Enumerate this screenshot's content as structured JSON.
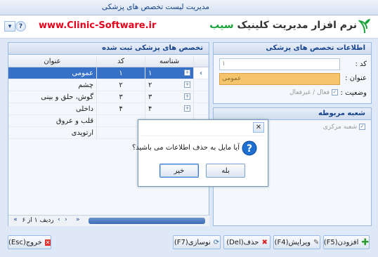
{
  "window": {
    "title": "مديريت ليست تخصص های پزشکی",
    "min_icon": "minimize-icon",
    "max_icon": "maximize-icon",
    "close_label": "✕"
  },
  "header": {
    "url": "www.Clinic-Software.ir",
    "logo_text_prefix": "نرم افزار مدیریت کلینیک ",
    "logo_text_brand": "سیب",
    "brand_color": "#18a33a",
    "url_color": "#e3001b"
  },
  "list_panel": {
    "title": "تخصص های پزشکی ثبت شده",
    "columns": [
      "شناسه",
      "کد",
      "عنوان"
    ],
    "rows": [
      {
        "id": "١",
        "code": "١",
        "title": "عمومی",
        "selected": true
      },
      {
        "id": "٢",
        "code": "٢",
        "title": "چشم",
        "selected": false
      },
      {
        "id": "٣",
        "code": "٣",
        "title": "گوش، حلق و بینی",
        "selected": false
      },
      {
        "id": "۴",
        "code": "۴",
        "title": "داخلی",
        "selected": false
      },
      {
        "id": "",
        "code": "",
        "title": "قلب و عروق",
        "selected": false
      },
      {
        "id": "",
        "code": "",
        "title": "ارتوپدی",
        "selected": false
      }
    ],
    "record_text": "ردیف ١ از ۶"
  },
  "info_panel": {
    "title": "اطلاعات تخصص های پزشکی",
    "code_label": "کد :",
    "code_value": "١",
    "title_label": "عنوان :",
    "title_value": "عمومی",
    "status_label": "وضعیت :",
    "status_text": "فعال / غیرفعال",
    "status_checked": true,
    "title_field_color": "#f6c46a"
  },
  "branch_panel": {
    "title": "شعبه مربوطه",
    "item": "شعبه مرکزی",
    "item_checked": true
  },
  "dialog": {
    "message": "آیا مایل به حذف اطلاعات می باشید؟",
    "yes_label": "بله",
    "no_label": "خیر",
    "close_label": "✕"
  },
  "toolbar": {
    "add_label": "افزودن(F5)",
    "edit_label": "ویرایش(F4)",
    "delete_label": "حذف(Del)",
    "refresh_label": "نوسازی(F7)",
    "exit_label": "خروج(Esc)"
  }
}
